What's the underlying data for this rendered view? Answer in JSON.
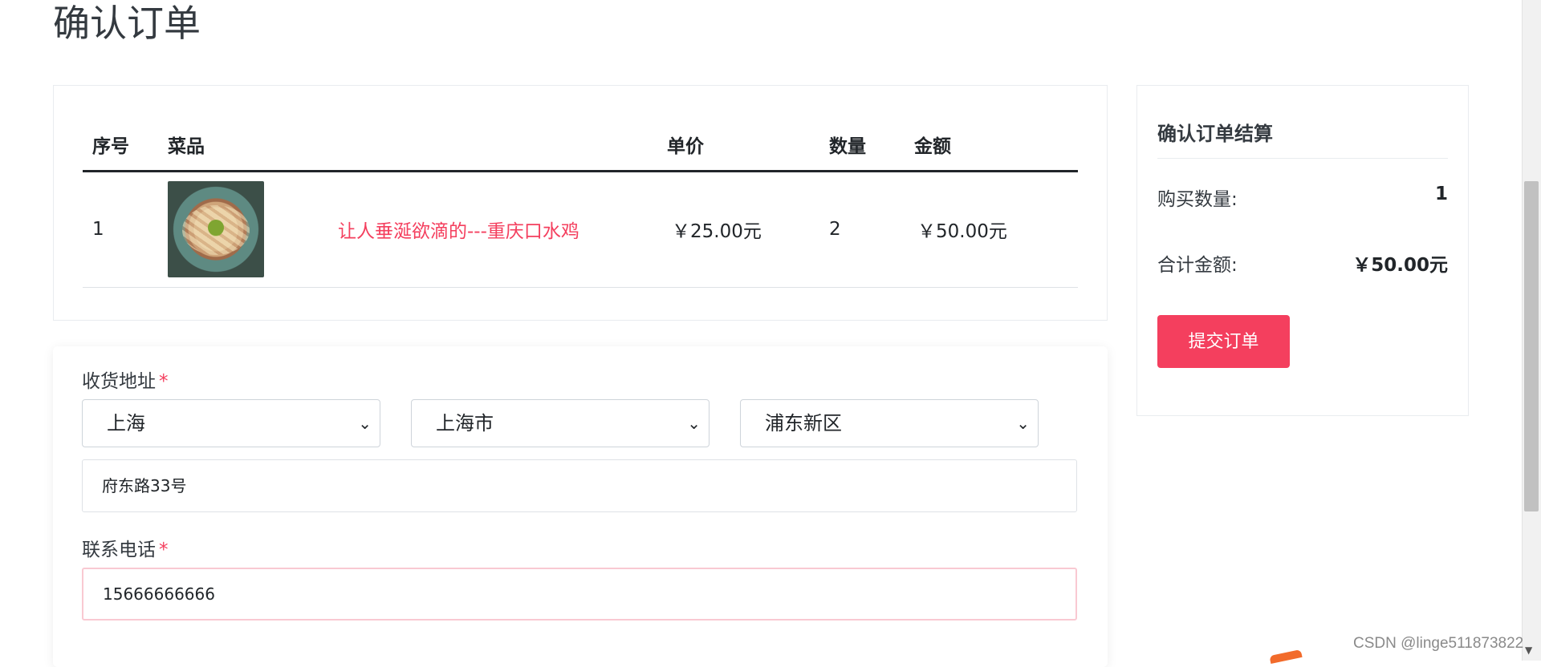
{
  "page": {
    "title": "确认订单"
  },
  "order_table": {
    "headers": {
      "index": "序号",
      "dish": "菜品",
      "price": "单价",
      "quantity": "数量",
      "amount": "金额"
    },
    "rows": [
      {
        "index": "1",
        "image_icon": "dish-photo",
        "name": "让人垂涎欲滴的---重庆口水鸡",
        "price": "￥25.00元",
        "quantity": "2",
        "amount": "￥50.00元"
      }
    ]
  },
  "address": {
    "label": "收货地址",
    "required_mark": "*",
    "province": "上海",
    "city": "上海市",
    "district": "浦东新区",
    "detail": "府东路33号"
  },
  "phone": {
    "label": "联系电话",
    "required_mark": "*",
    "value": "15666666666"
  },
  "summary": {
    "title": "确认订单结算",
    "purchase_count_label": "购买数量:",
    "purchase_count_value": "1",
    "total_label": "合计金额:",
    "total_value": "￥50.00元",
    "submit_label": "提交订单"
  },
  "watermark": "CSDN @linge511873822",
  "colors": {
    "accent": "#f43f5e",
    "text": "#212529",
    "border": "#dee2e6"
  }
}
